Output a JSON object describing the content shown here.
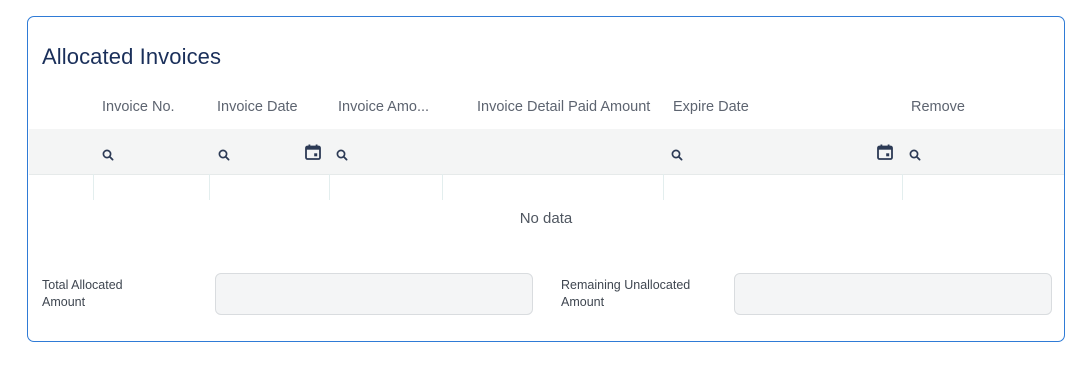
{
  "panel": {
    "title": "Allocated Invoices"
  },
  "table": {
    "columns": [
      {
        "label": "Invoice No."
      },
      {
        "label": "Invoice Date"
      },
      {
        "label": "Invoice Amo..."
      },
      {
        "label": "Invoice Detail Paid Amount"
      },
      {
        "label": "Expire Date"
      },
      {
        "label": "Remove"
      }
    ],
    "empty_text": "No data",
    "filter_icons": [
      "search-icon",
      "calendar-icon"
    ]
  },
  "summary": {
    "total_label": "Total Allocated\nAmount",
    "total_value": "",
    "remaining_label": "Remaining Unallocated\nAmount",
    "remaining_value": ""
  },
  "colors": {
    "border_accent": "#2f7bd6",
    "title": "#1a2f5a",
    "filter_row_bg": "#f4f5f5",
    "input_bg": "#f4f5f6"
  }
}
